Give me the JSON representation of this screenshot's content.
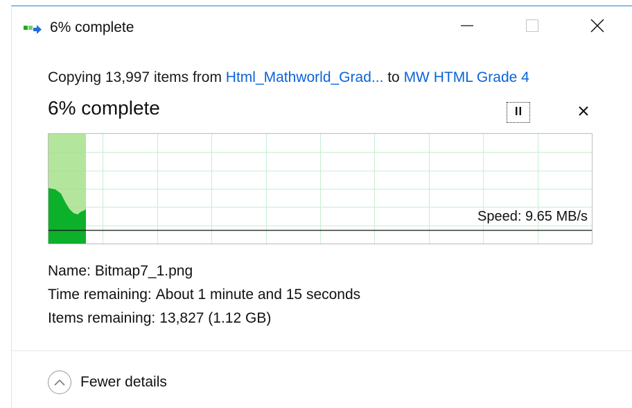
{
  "window": {
    "title": "6% complete",
    "icon": "copy-files-icon",
    "controls": {
      "minimize": "minimize-icon",
      "maximize": "maximize-icon",
      "close": "close-icon"
    }
  },
  "operation": {
    "prefix": "Copying 13,997 items from ",
    "source": "Html_Mathworld_Grad...",
    "connector": " to ",
    "destination": "MW HTML Grade 4"
  },
  "progress": {
    "label": "6% complete",
    "percent": 6,
    "pause_icon": "pause-icon",
    "cancel_icon": "cancel-icon"
  },
  "speed_graph": {
    "speed_label": "Speed: 9.65 MB/s",
    "fill_color": "#a6e08c",
    "history_color": "#0db02b",
    "grid_color": "#c6eed2"
  },
  "details": {
    "name_label": "Name:",
    "name_value": "Bitmap7_1.png",
    "time_label": "Time remaining:",
    "time_value": "About 1 minute and 15 seconds",
    "items_label": "Items remaining:",
    "items_value": "13,827 (1.12 GB)"
  },
  "footer": {
    "toggle_label": "Fewer details",
    "toggle_icon": "chevron-up-icon"
  },
  "colors": {
    "accent": "#1883d7",
    "link": "#0a64d8"
  }
}
